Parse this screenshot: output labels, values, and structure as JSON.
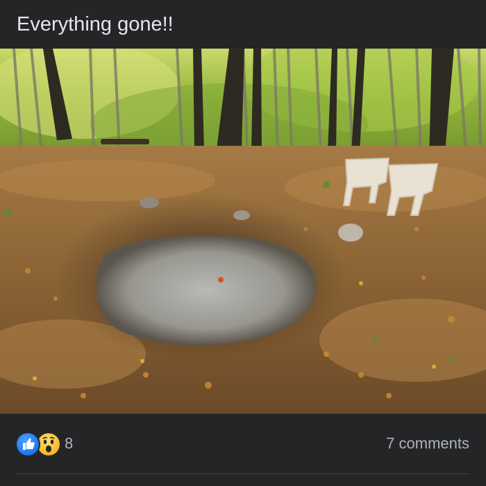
{
  "post": {
    "text": "Everything gone!!"
  },
  "photo": {
    "subject": "ash-pile-in-forest-clearing"
  },
  "reactions": {
    "icons": [
      "like-icon",
      "wow-icon"
    ],
    "count": "8",
    "comments_label": "7 comments"
  },
  "colors": {
    "background": "#242526",
    "text_primary": "#e4e6eb",
    "text_secondary": "#b0b3b8",
    "like_blue": "#1877f2",
    "wow_yellow": "#f7b125"
  }
}
